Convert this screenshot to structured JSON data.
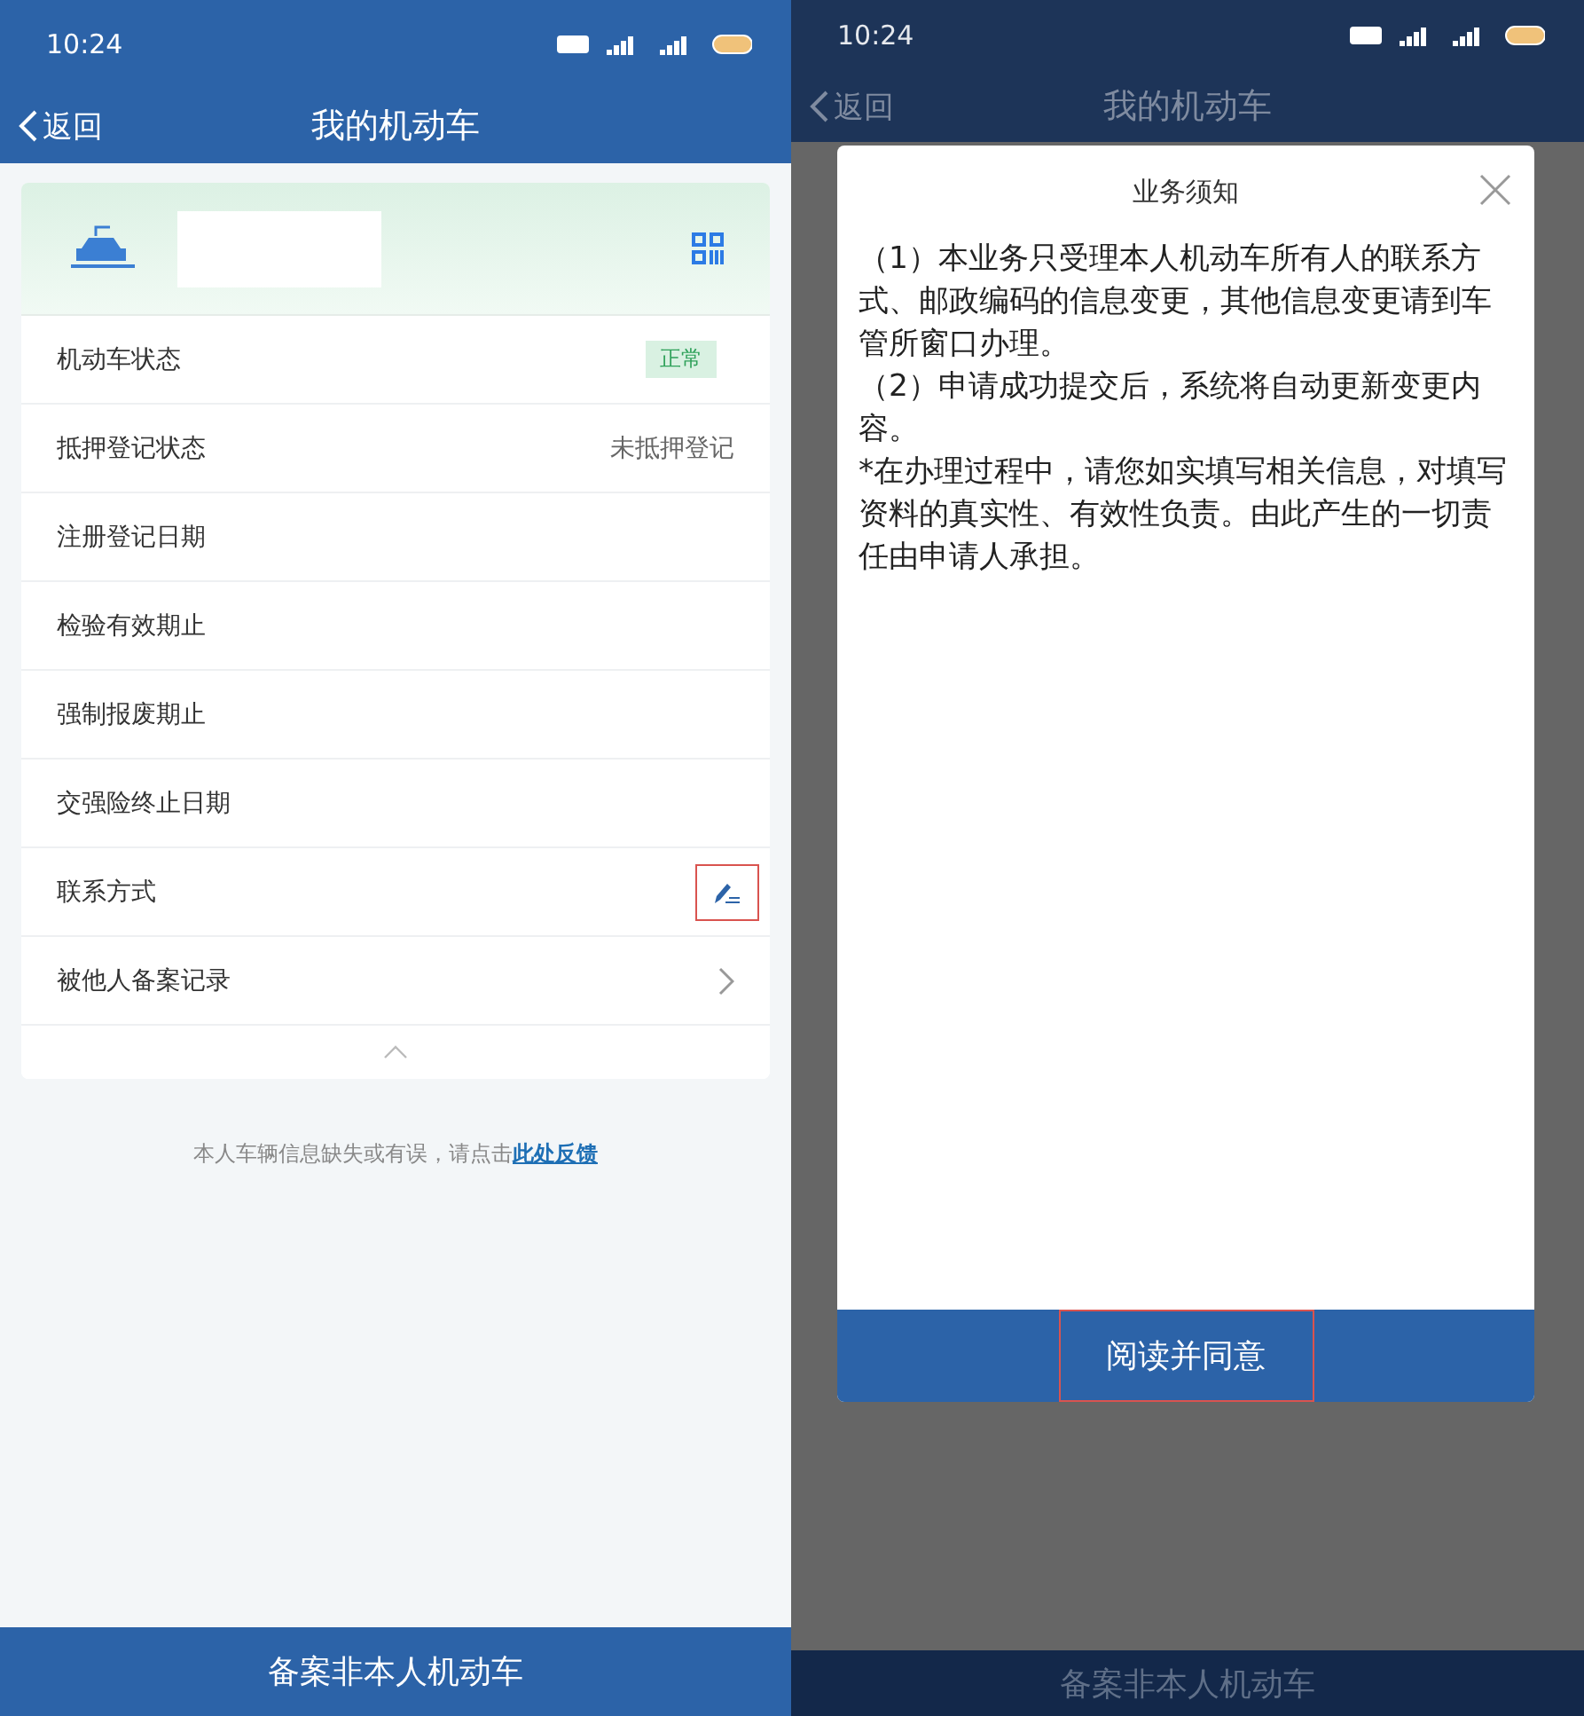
{
  "left_screen": {
    "status_bar": {
      "time": "10:24"
    },
    "nav": {
      "back": "返回",
      "title": "我的机动车"
    },
    "vehicle_card": {
      "rows": [
        {
          "kind": "badge",
          "label": "机动车状态",
          "value": "正常"
        },
        {
          "kind": "text",
          "label": "抵押登记状态",
          "value": "未抵押登记"
        },
        {
          "kind": "plain",
          "label": "注册登记日期"
        },
        {
          "kind": "plain",
          "label": "检验有效期止"
        },
        {
          "kind": "plain",
          "label": "强制报废期止"
        },
        {
          "kind": "plain",
          "label": "交强险终止日期"
        },
        {
          "kind": "edit",
          "label": "联系方式",
          "highlighted": true
        },
        {
          "kind": "chevron",
          "label": "被他人备案记录"
        }
      ],
      "expanded": true
    },
    "feedback": {
      "text": "本人车辆信息缺失或有误，请点击",
      "link": "此处反馈"
    },
    "bottom_button": "备案非本人机动车"
  },
  "right_screen": {
    "status_bar": {
      "time": "10:24"
    },
    "nav": {
      "back": "返回",
      "title": "我的机动车"
    },
    "dialog": {
      "title": "业务须知",
      "paragraphs": [
        "（1）本业务只受理本人机动车所有人的联系方式、邮政编码的信息变更，其他信息变更请到车管所窗口办理。",
        "（2）申请成功提交后，系统将自动更新变更内容。",
        "*在办理过程中，请您如实填写相关信息，对填写资料的真实性、有效性负责。由此产生的一切责任由申请人承担。"
      ],
      "button": {
        "label": "阅读并同意",
        "highlighted": true
      }
    },
    "bottom_button": "备案非本人机动车"
  }
}
